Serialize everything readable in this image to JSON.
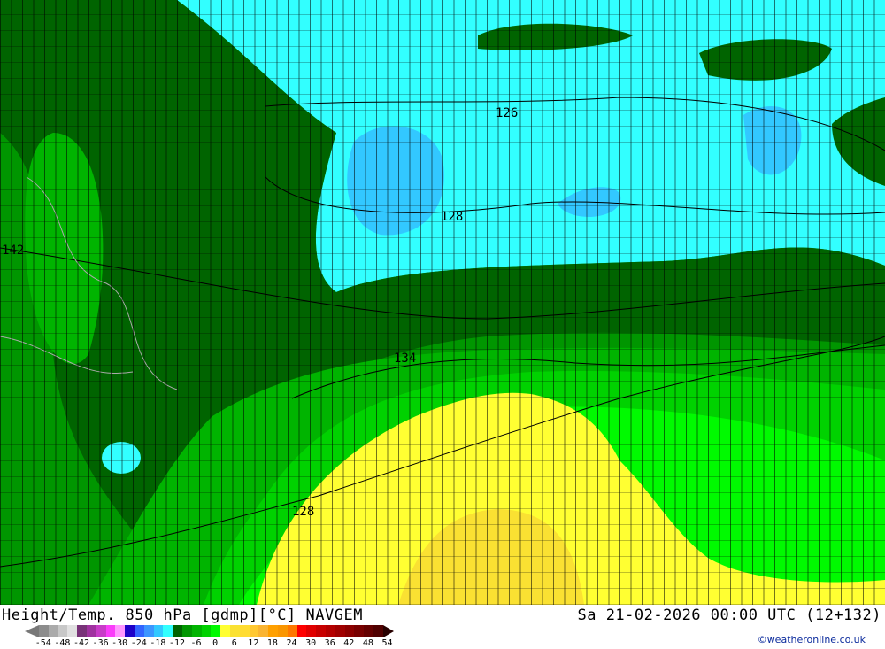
{
  "title": "Height/Temp. 850 hPa [gdmp][°C] NAVGEM",
  "datetime": "Sa 21-02-2026 00:00 UTC (12+132)",
  "credit": "©weatheronline.co.uk",
  "colorbar": {
    "colors": [
      "#8c8c8c",
      "#aaaaaa",
      "#c8c8c8",
      "#e1e1e1",
      "#783278",
      "#a032a0",
      "#c83cc8",
      "#fa3cfa",
      "#ff96ff",
      "#1e00c8",
      "#3264ff",
      "#3c96ff",
      "#32c8ff",
      "#32ffff",
      "#006400",
      "#009600",
      "#00b400",
      "#00d200",
      "#00fa00",
      "#ffff32",
      "#fae132",
      "#ffdc32",
      "#ffc832",
      "#fab432",
      "#ffa000",
      "#fa9600",
      "#ff7800",
      "#ff0000",
      "#e10000",
      "#c80000",
      "#b40000",
      "#a00000",
      "#8c0000",
      "#780000",
      "#640000",
      "#500000"
    ],
    "ticks": [
      "-54",
      "-48",
      "-42",
      "-36",
      "-30",
      "-24",
      "-18",
      "-12",
      "-6",
      "0",
      "6",
      "12",
      "18",
      "24",
      "30",
      "36",
      "42",
      "48",
      "54"
    ]
  },
  "contour_labels": [
    "126",
    "128",
    "134",
    "142",
    "128"
  ],
  "colors": {
    "cyan": "#32ffff",
    "lightblue": "#32c8ff",
    "darkgreen": "#006400",
    "green": "#009600",
    "green2": "#00b400",
    "green3": "#00d200",
    "lime": "#00fa00",
    "yellow": "#ffff32",
    "gold": "#fae132"
  }
}
